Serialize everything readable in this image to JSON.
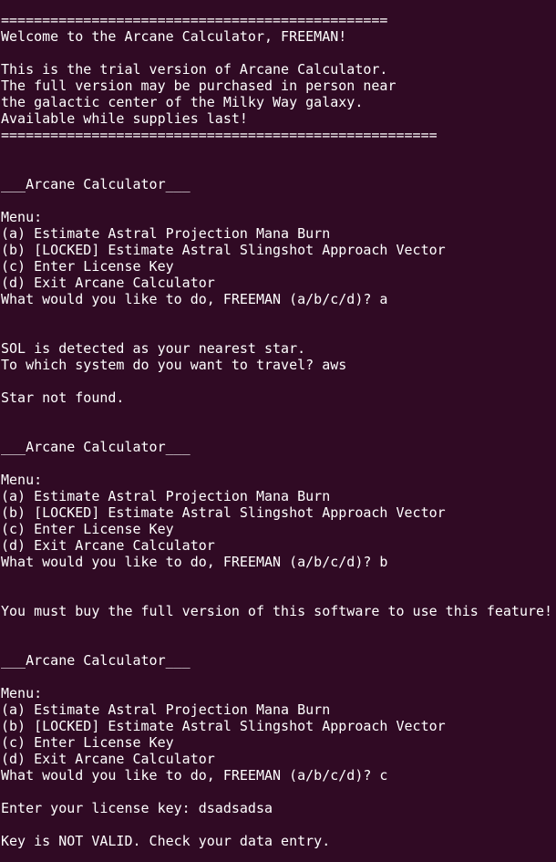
{
  "terminal": {
    "lines": [
      "===============================================",
      "Welcome to the Arcane Calculator, FREEMAN!",
      "",
      "This is the trial version of Arcane Calculator.",
      "The full version may be purchased in person near",
      "the galactic center of the Milky Way galaxy.",
      "Available while supplies last!",
      "=====================================================",
      "",
      "",
      "___Arcane Calculator___",
      "",
      "Menu:",
      "(a) Estimate Astral Projection Mana Burn",
      "(b) [LOCKED] Estimate Astral Slingshot Approach Vector",
      "(c) Enter License Key",
      "(d) Exit Arcane Calculator",
      "What would you like to do, FREEMAN (a/b/c/d)? a",
      "",
      "",
      "SOL is detected as your nearest star.",
      "To which system do you want to travel? aws",
      "",
      "Star not found.",
      "",
      "",
      "___Arcane Calculator___",
      "",
      "Menu:",
      "(a) Estimate Astral Projection Mana Burn",
      "(b) [LOCKED] Estimate Astral Slingshot Approach Vector",
      "(c) Enter License Key",
      "(d) Exit Arcane Calculator",
      "What would you like to do, FREEMAN (a/b/c/d)? b",
      "",
      "",
      "You must buy the full version of this software to use this feature!",
      "",
      "",
      "___Arcane Calculator___",
      "",
      "Menu:",
      "(a) Estimate Astral Projection Mana Burn",
      "(b) [LOCKED] Estimate Astral Slingshot Approach Vector",
      "(c) Enter License Key",
      "(d) Exit Arcane Calculator",
      "What would you like to do, FREEMAN (a/b/c/d)? c",
      "",
      "Enter your license key: dsadsadsa",
      "",
      "Key is NOT VALID. Check your data entry."
    ]
  }
}
